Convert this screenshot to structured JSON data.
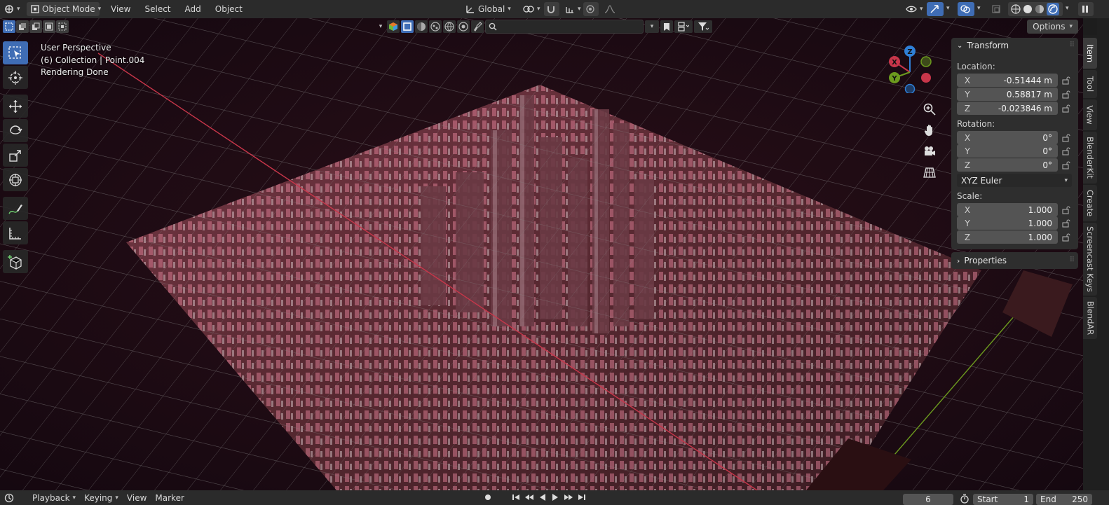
{
  "header": {
    "mode": "Object Mode",
    "menus": [
      "View",
      "Select",
      "Add",
      "Object"
    ],
    "orientation": "Global"
  },
  "tool_header": {
    "search_placeholder": "",
    "options_label": "Options"
  },
  "viewport": {
    "perspective": "User Perspective",
    "collection": "(6) Collection | Point.004",
    "status": "Rendering Done"
  },
  "gizmo": {
    "x_label": "X",
    "y_label": "Y",
    "z_label": "Z"
  },
  "npanel": {
    "transform_title": "Transform",
    "location_label": "Location:",
    "location": [
      {
        "axis": "X",
        "value": "-0.51444 m"
      },
      {
        "axis": "Y",
        "value": "0.58817 m"
      },
      {
        "axis": "Z",
        "value": "-0.023846 m"
      }
    ],
    "rotation_label": "Rotation:",
    "rotation": [
      {
        "axis": "X",
        "value": "0°"
      },
      {
        "axis": "Y",
        "value": "0°"
      },
      {
        "axis": "Z",
        "value": "0°"
      }
    ],
    "rotation_mode": "XYZ Euler",
    "scale_label": "Scale:",
    "scale": [
      {
        "axis": "X",
        "value": "1.000"
      },
      {
        "axis": "Y",
        "value": "1.000"
      },
      {
        "axis": "Z",
        "value": "1.000"
      }
    ],
    "properties_title": "Properties"
  },
  "side_tabs": [
    "Item",
    "Tool",
    "View",
    "BlenderKit",
    "Create",
    "Screencast Keys",
    "BlendAR"
  ],
  "timeline": {
    "menus": [
      "Playback",
      "Keying",
      "View",
      "Marker"
    ],
    "current_frame": "6",
    "start_label": "Start",
    "start_value": "1",
    "end_label": "End",
    "end_value": "250"
  },
  "colors": {
    "accent": "#3f6db5",
    "axis_x": "#c8364a",
    "axis_y": "#6c9a1e",
    "axis_z": "#2f7fd6",
    "city_glow": "#e8869e"
  }
}
